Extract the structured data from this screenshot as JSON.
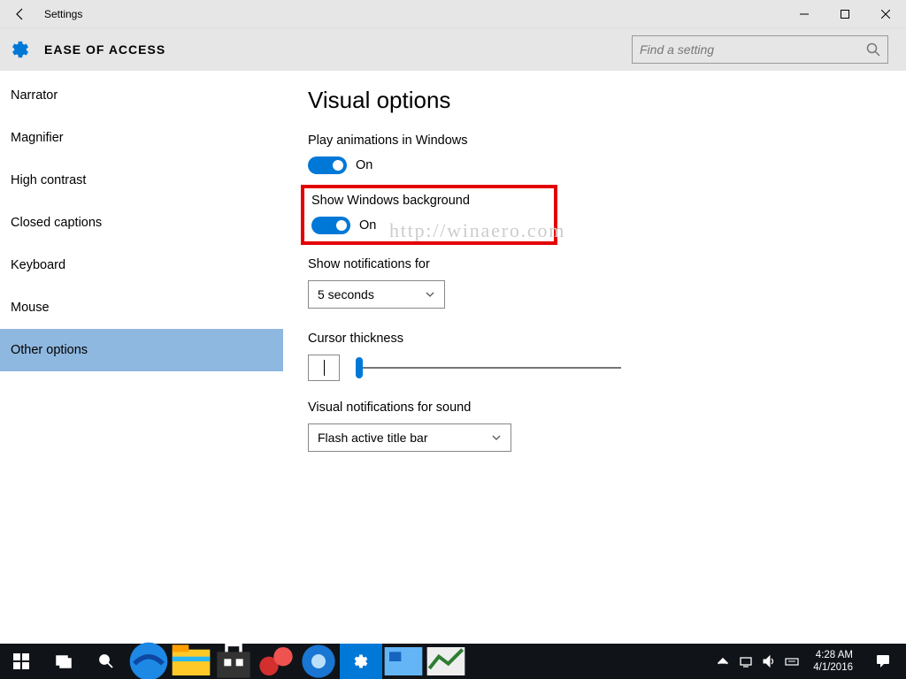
{
  "titlebar": {
    "title": "Settings"
  },
  "header": {
    "category": "EASE OF ACCESS",
    "search_placeholder": "Find a setting"
  },
  "sidebar": {
    "items": [
      {
        "label": "Narrator",
        "selected": false
      },
      {
        "label": "Magnifier",
        "selected": false
      },
      {
        "label": "High contrast",
        "selected": false
      },
      {
        "label": "Closed captions",
        "selected": false
      },
      {
        "label": "Keyboard",
        "selected": false
      },
      {
        "label": "Mouse",
        "selected": false
      },
      {
        "label": "Other options",
        "selected": true
      }
    ]
  },
  "content": {
    "heading": "Visual options",
    "play_animations": {
      "label": "Play animations in Windows",
      "state": "On"
    },
    "show_background": {
      "label": "Show Windows background",
      "state": "On"
    },
    "notifications_for": {
      "label": "Show notifications for",
      "value": "5 seconds"
    },
    "cursor_thickness": {
      "label": "Cursor thickness"
    },
    "visual_notifications": {
      "label": "Visual notifications for sound",
      "value": "Flash active title bar"
    },
    "watermark": "http://winaero.com"
  },
  "taskbar": {
    "time": "4:28 AM",
    "date": "4/1/2016"
  }
}
